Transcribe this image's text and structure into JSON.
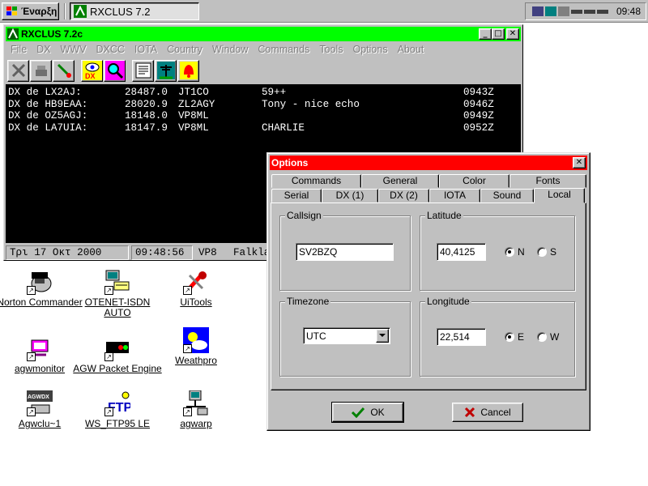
{
  "taskbar": {
    "start_label": "Έναρξη",
    "task_label": "RXCLUS 7.2",
    "clock": "09:48"
  },
  "main_window": {
    "title": "RXCLUS 7.2c",
    "menu": [
      "File",
      "DX",
      "WWV",
      "DXCC",
      "IOTA",
      "Country",
      "Window",
      "Commands",
      "Tools",
      "Options",
      "About"
    ],
    "spots": [
      {
        "spotter": "DX de LX2AJ:",
        "freq": "28487.0",
        "call": "JT1CO",
        "comment": "59++",
        "time": "0943Z"
      },
      {
        "spotter": "DX de HB9EAA:",
        "freq": "28020.9",
        "call": "ZL2AGY",
        "comment": "Tony - nice echo",
        "time": "0946Z"
      },
      {
        "spotter": "DX de OZ5AGJ:",
        "freq": "18148.0",
        "call": "VP8ML",
        "comment": "",
        "time": "0949Z"
      },
      {
        "spotter": "DX de LA7UIA:",
        "freq": "18147.9",
        "call": "VP8ML",
        "comment": "CHARLIE",
        "time": "0952Z"
      }
    ],
    "status": {
      "date": "Τρι 17 Οκτ 2000",
      "time": "09:48:56",
      "prefix": "VP8",
      "country": "Falkla"
    }
  },
  "desktop_icons": [
    {
      "label": "Norton Commander"
    },
    {
      "label": "OTENET-ISDN AUTO"
    },
    {
      "label": "UiTools"
    },
    {
      "label": "agwmonitor"
    },
    {
      "label": "AGW Packet Engine"
    },
    {
      "label": "Weathpro"
    },
    {
      "label": "Agwclu~1",
      "badge": "AGWDX"
    },
    {
      "label": "WS_FTP95 LE",
      "badge": "FTP"
    },
    {
      "label": "agwarp"
    }
  ],
  "options_dialog": {
    "title": "Options",
    "tabs_back": [
      "Commands",
      "General",
      "Color",
      "Fonts"
    ],
    "tabs_front": [
      "Serial",
      "DX (1)",
      "DX (2)",
      "IOTA",
      "Sound",
      "Local"
    ],
    "active_tab": "Local",
    "callsign": {
      "label": "Callsign",
      "value": "SV2BZQ"
    },
    "latitude": {
      "label": "Latitude",
      "value": "40,4125",
      "opt1": "N",
      "opt2": "S",
      "selected": "N"
    },
    "timezone": {
      "label": "Timezone",
      "value": "UTC"
    },
    "longitude": {
      "label": "Longitude",
      "value": "22,514",
      "opt1": "E",
      "opt2": "W",
      "selected": "E"
    },
    "ok_label": "OK",
    "cancel_label": "Cancel"
  },
  "colors": {
    "main_titlebar": "#00ff00",
    "dialog_titlebar": "#ff0000",
    "face": "#c0c0c0"
  }
}
